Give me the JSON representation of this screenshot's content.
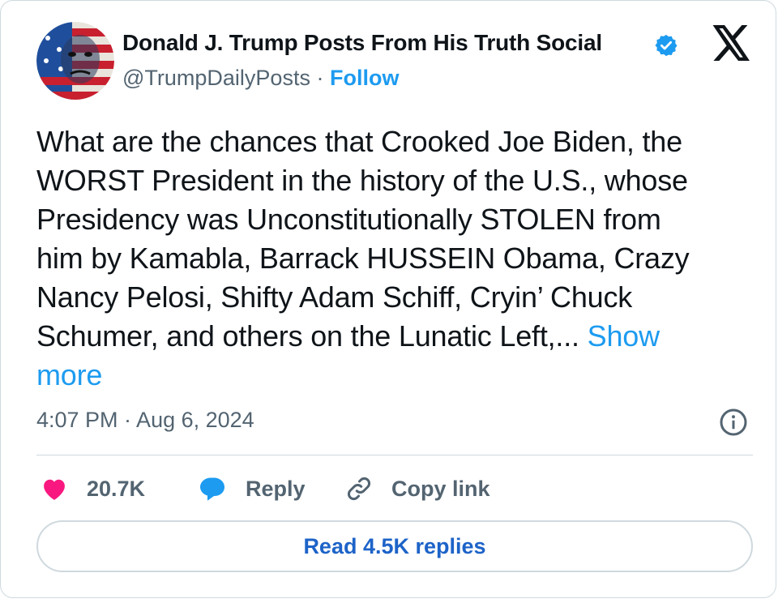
{
  "author": {
    "name": "Donald J. Trump Posts From His Truth Social",
    "handle": "@TrumpDailyPosts",
    "separator": "·",
    "follow_label": "Follow",
    "verified": true
  },
  "post": {
    "lines": [
      "What are the chances that Crooked Joe Biden, the",
      "WORST President in the history of the U.S., whose",
      "Presidency was Unconstitutionally STOLEN from",
      "him by Kamabla, Barrack HUSSEIN Obama, Crazy",
      "Nancy Pelosi, Shifty Adam Schiff, Cryin’ Chuck",
      "Schumer, and others on the Lunatic Left,..."
    ],
    "show_more_part1": "Show",
    "show_more_part2": "more",
    "timestamp": "4:07 PM · Aug 6, 2024"
  },
  "actions": {
    "like_count": "20.7K",
    "reply_label": "Reply",
    "copy_label": "Copy link"
  },
  "read_replies_label": "Read 4.5K replies",
  "colors": {
    "accent": "#1d9bf0",
    "like": "#f91880",
    "text": "#0f1419",
    "muted": "#536471",
    "border": "#cfd9de"
  },
  "icons": [
    "verified-badge-icon",
    "x-logo-icon",
    "info-icon",
    "heart-icon",
    "reply-bubble-icon",
    "link-icon"
  ]
}
